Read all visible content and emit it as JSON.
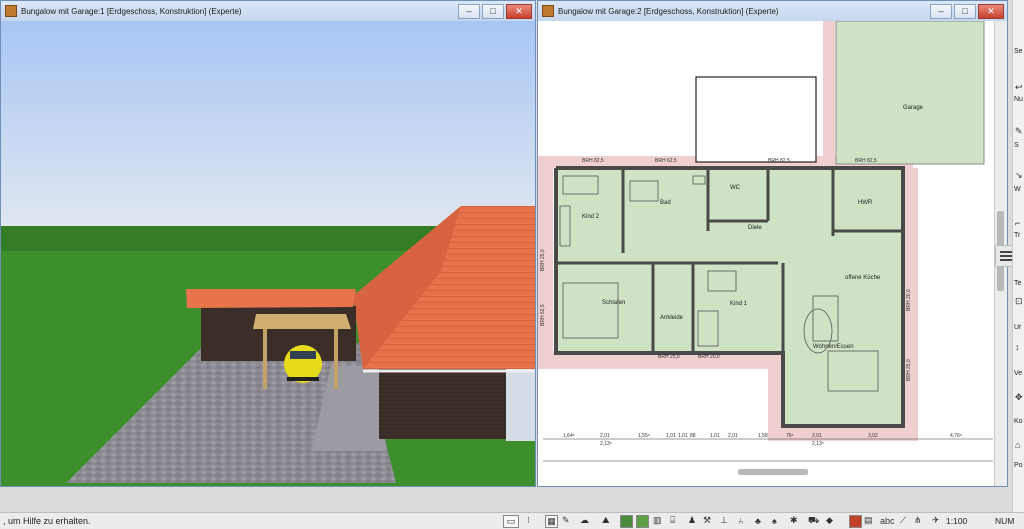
{
  "window_3d": {
    "title": "Bungalow mit Garage:1 [Erdgeschoss, Konstruktion] (Experte)"
  },
  "window_plan": {
    "title": "Bungalow mit Garage:2 [Erdgeschoss, Konstruktion] (Experte)"
  },
  "window_controls": {
    "minimize": "–",
    "maximize": "□",
    "close": "✕"
  },
  "plan": {
    "rooms": [
      {
        "id": "garage",
        "label": "Garage"
      },
      {
        "id": "bad",
        "label": "Bad"
      },
      {
        "id": "wc",
        "label": "WC"
      },
      {
        "id": "hwr",
        "label": "HWR"
      },
      {
        "id": "kind2",
        "label": "Kind 2"
      },
      {
        "id": "diele",
        "label": "Diele"
      },
      {
        "id": "schlafen",
        "label": "Schlafen"
      },
      {
        "id": "ankleide",
        "label": "Ankleide"
      },
      {
        "id": "kind1",
        "label": "Kind 1"
      },
      {
        "id": "kueche",
        "label": "offene Küche"
      },
      {
        "id": "wohnen",
        "label": "Wohnen/Essen"
      }
    ],
    "window_tags": [
      "BRH 82,5",
      "BRH 62,5",
      "BRH 82,5",
      "BRH 82,5",
      "BRH 25,0",
      "BRH 62,5",
      "BRH 25,0",
      "BRH 20,0",
      "BRH 20,0",
      "BRH 25,0"
    ],
    "dimensions": [
      "1,64⁵",
      "2,01",
      "2,13⁵",
      "1,55⁵",
      "1,01",
      "1,01",
      "88",
      "1,01",
      "2,01",
      "1,58",
      "76⁵",
      "2,01",
      "2,13⁵",
      "3,02",
      "4,76⁵"
    ]
  },
  "sidebar": {
    "items": [
      {
        "icon": "·",
        "text": "Se"
      },
      {
        "icon": "↩",
        "text": "Nu"
      },
      {
        "icon": "✎",
        "text": "S"
      },
      {
        "icon": "↘",
        "text": "W"
      },
      {
        "icon": "⌐",
        "text": "Tr"
      },
      {
        "icon": "≡",
        "text": "Te"
      },
      {
        "icon": "⊡",
        "text": "Ur"
      },
      {
        "icon": "↕",
        "text": "Ve"
      },
      {
        "icon": "✥",
        "text": "Ko"
      },
      {
        "icon": "⌂",
        "text": "Po"
      }
    ]
  },
  "statusbar": {
    "help_text": ", um Hilfe zu erhalten.",
    "scale": "1:100",
    "num": "NUM",
    "abc": "abc"
  },
  "colors": {
    "roof": "#e8734a",
    "lawn": "#3c8f2a",
    "sky": "#c9d8ee",
    "room_fill": "#cfe3c4",
    "wall": "#555555",
    "terrain": "#e8c9c9"
  }
}
